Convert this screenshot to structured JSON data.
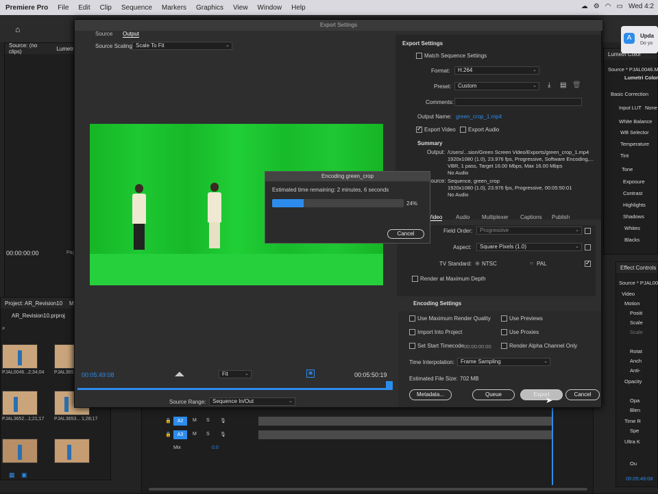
{
  "menubar": {
    "app": "Premiere Pro",
    "items": [
      "File",
      "Edit",
      "Clip",
      "Sequence",
      "Markers",
      "Graphics",
      "View",
      "Window",
      "Help"
    ],
    "clock": "Wed 4:2"
  },
  "notification": {
    "title": "Upda",
    "body": "Do yo"
  },
  "source_panel": {
    "tab": "Source: (no clips)",
    "tab2": "Lumetri",
    "timecode": "00:00:00:00",
    "page": "Page"
  },
  "project_panel": {
    "tab": "Project: AR_Revision10",
    "tab2": "M",
    "file": "AR_Revision10.prproj",
    "clips": [
      {
        "name": "PJAL0046...",
        "dur": "2;34;04"
      },
      {
        "name": "PJAL3651...",
        "dur": ""
      },
      {
        "name": "PJAL3652...",
        "dur": "1;21;17"
      },
      {
        "name": "PJAL3653...",
        "dur": "1;28;17"
      }
    ]
  },
  "dialog": {
    "title": "Export Settings",
    "tabs": [
      "Source",
      "Output"
    ],
    "source_scaling_label": "Source Scaling:",
    "source_scaling_value": "Scale To Fit",
    "tc_in": "00:05:49:08",
    "tc_out": "00:05:50:19",
    "fit": "Fit",
    "source_range_label": "Source Range:",
    "source_range_value": "Sequence In/Out"
  },
  "export_settings": {
    "header": "Export Settings",
    "match_sequence": "Match Sequence Settings",
    "format_label": "Format:",
    "format_value": "H.264",
    "preset_label": "Preset:",
    "preset_value": "Custom",
    "comments_label": "Comments:",
    "output_name_label": "Output Name:",
    "output_name_value": "green_crop_1.mp4",
    "export_video": "Export Video",
    "export_audio": "Export Audio",
    "summary_header": "Summary",
    "output_label": "Output:",
    "output_lines": [
      "/Users/...sion/Green Screen Video/Exports/green_crop_1.mp4",
      "1920x1080 (1.0), 23.976 fps, Progressive, Software Encoding,...",
      "VBR, 1 pass, Target 16.00 Mbps, Max 16.00 Mbps",
      "No Audio"
    ],
    "source_label": "Source:",
    "source_lines": [
      "Sequence, green_crop",
      "1920x1080 (1.0), 23.976 fps, Progressive, 00:05:50:01",
      "No Audio"
    ],
    "tabs": [
      "Video",
      "Audio",
      "Multiplexer",
      "Captions",
      "Publish"
    ],
    "field_order_label": "Field Order:",
    "field_order_value": "Progressive",
    "aspect_label": "Aspect:",
    "aspect_value": "Square Pixels (1.0)",
    "tv_standard_label": "TV Standard:",
    "ntsc": "NTSC",
    "pal": "PAL",
    "render_max_depth": "Render at Maximum Depth",
    "encoding_settings": "Encoding Settings",
    "use_max_render": "Use Maximum Render Quality",
    "use_previews": "Use Previews",
    "import_into_project": "Import Into Project",
    "use_proxies": "Use Proxies",
    "set_start_timecode": "Set Start Timecode",
    "start_tc": "00:00:00:00",
    "render_alpha": "Render Alpha Channel Only",
    "time_interp_label": "Time Interpolation:",
    "time_interp_value": "Frame Sampling",
    "est_size_label": "Estimated File Size:",
    "est_size_value": "702 MB",
    "metadata_btn": "Metadata...",
    "queue_btn": "Queue",
    "export_btn": "Export",
    "cancel_btn": "Cancel"
  },
  "encoding": {
    "title": "Encoding green_crop",
    "remaining": "Estimated time remaining: 2 minutes, 6 seconds",
    "percent": "24%",
    "progress": 0.24,
    "cancel": "Cancel"
  },
  "lumetri": {
    "tab": "Lumetri Color",
    "source": "Source * PJAL0046.MOV",
    "subtab": "Lumetri Color",
    "basic": "Basic Correction",
    "input_lut": "Input LUT",
    "input_lut_val": "None",
    "white_balance": "White Balance",
    "wb_selector": "WB Selector",
    "temperature": "Temperature",
    "tint": "Tint",
    "tone": "Tone",
    "tone_items": [
      "Exposure",
      "Contrast",
      "Highlights",
      "Shadows",
      "Whites",
      "Blacks"
    ]
  },
  "effect_controls": {
    "tab": "Effect Controls",
    "source": "Source * PJAL004",
    "video": "Video",
    "items": [
      "Motion",
      "Positi",
      "Scale",
      "Scale",
      "Rotat",
      "Anch",
      "Anti-",
      "Opacity",
      "Opa",
      "Blen",
      "Time R",
      "Spe",
      "Ultra K",
      "Ou"
    ],
    "timecode": "00:05:49:08"
  },
  "timeline": {
    "tracks": [
      {
        "name": "A2"
      },
      {
        "name": "A3"
      }
    ],
    "mix": "Mix",
    "mix_val": "0.0",
    "ss": "S S"
  }
}
